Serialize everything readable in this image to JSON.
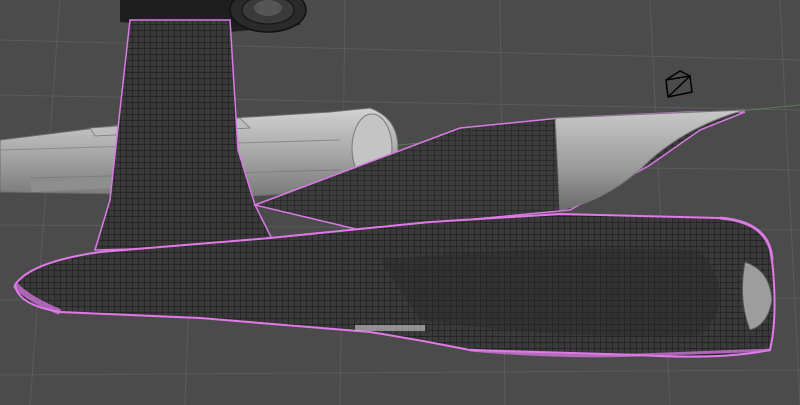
{
  "viewport": {
    "kind": "3d-viewport",
    "mode": "edit-mode-wireframe-overlay"
  },
  "scene": {
    "background_color": "#4b4b4b",
    "grid_color": "#5a5a5a",
    "model_color": "#a8a8a8",
    "wire_color": "#1a1a1a",
    "selection_color": "#e07ae8",
    "camera_object_color": "#000000"
  },
  "icons": {
    "camera": "camera-icon"
  }
}
